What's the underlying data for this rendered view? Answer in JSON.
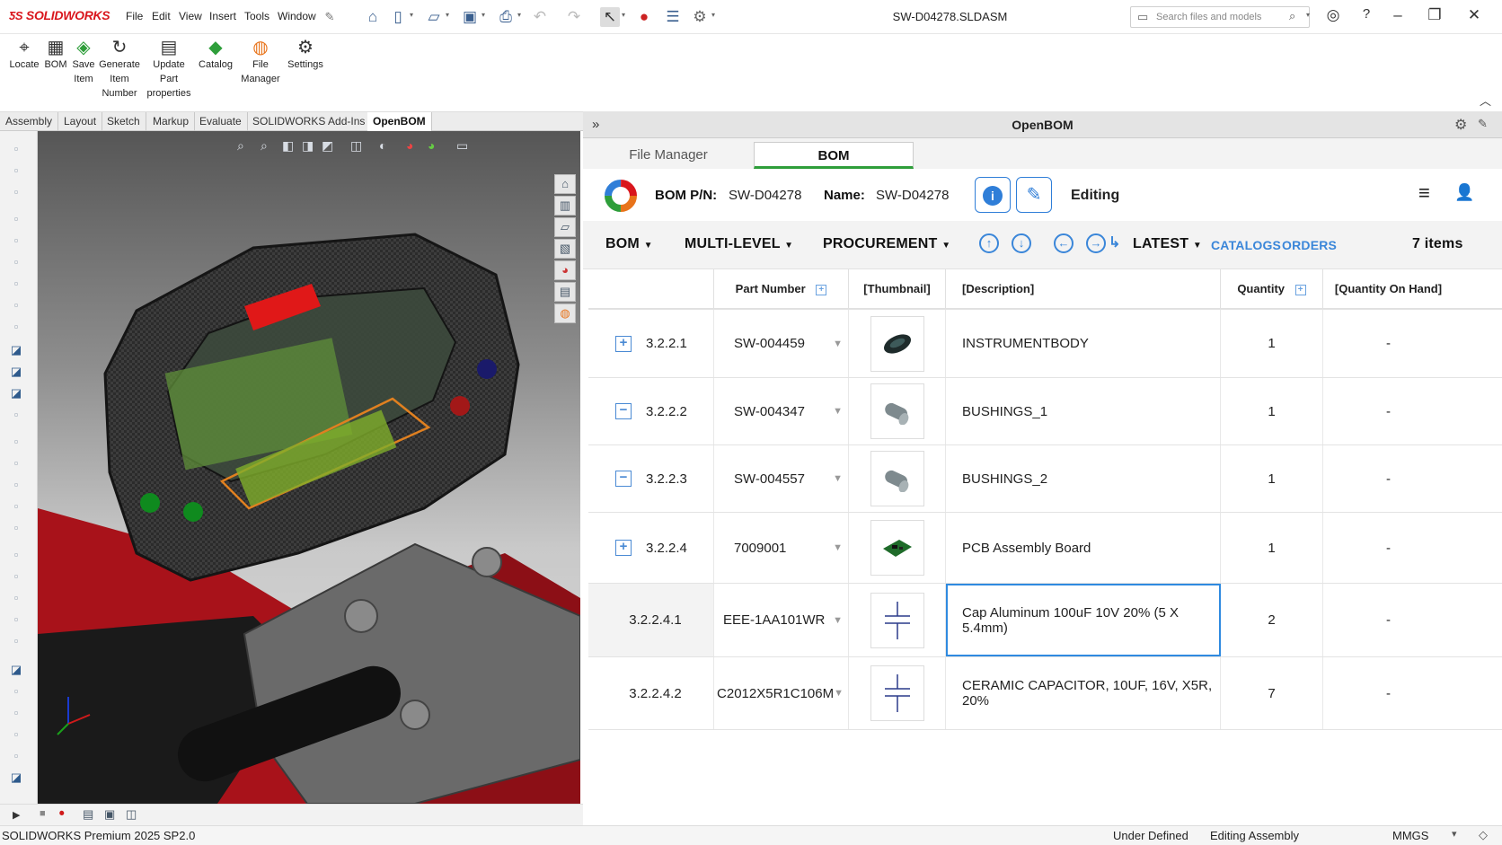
{
  "app": {
    "brand": "SOLIDWORKS",
    "window_title": "SW-D04278.SLDASM",
    "menus": [
      "File",
      "Edit",
      "View",
      "Insert",
      "Tools",
      "Window"
    ],
    "search_placeholder": "Search files and models"
  },
  "ribbon": {
    "buttons": [
      {
        "label": "Locate",
        "icon": "pin-icon"
      },
      {
        "label": "BOM",
        "icon": "grid-icon"
      },
      {
        "label": "Save Item",
        "icon": "cube-icon"
      },
      {
        "label": "Generate Item Number",
        "icon": "refresh-icon"
      },
      {
        "label": "Update Part properties",
        "icon": "document-refresh-icon"
      },
      {
        "label": "Catalog",
        "icon": "cube-stack-icon"
      },
      {
        "label": "File Manager",
        "icon": "openbom-ring-icon"
      },
      {
        "label": "Settings",
        "icon": "gear-icon"
      }
    ]
  },
  "cmd_tabs": [
    "Assembly",
    "Layout",
    "Sketch",
    "Markup",
    "Evaluate",
    "SOLIDWORKS Add-Ins",
    "OpenBOM"
  ],
  "active_cmd_tab": "OpenBOM",
  "panel": {
    "title": "OpenBOM",
    "tabs": [
      "File Manager",
      "BOM"
    ],
    "active_tab": "BOM",
    "bom_pn_label": "BOM P/N:",
    "bom_pn_value": "SW-D04278",
    "name_label": "Name:",
    "name_value": "SW-D04278",
    "mode": "Editing",
    "toolbar": {
      "bom": "BOM",
      "multilevel": "MULTI-LEVEL",
      "procurement": "PROCUREMENT",
      "latest": "LATEST",
      "catalogs": "CATALOGS",
      "orders": "ORDERS",
      "count": "7 items"
    },
    "columns": [
      "Part Number",
      "[Thumbnail]",
      "[Description]",
      "Quantity",
      "[Quantity On Hand]"
    ],
    "rows": [
      {
        "level": "3.2.2.1",
        "expander": "+",
        "part": "SW-004459",
        "desc": "INSTRUMENTBODY",
        "qty": "1",
        "onhand": "-",
        "thumb": "instrument-body-thumbnail"
      },
      {
        "level": "3.2.2.2",
        "expander": "−",
        "part": "SW-004347",
        "desc": "BUSHINGS_1",
        "qty": "1",
        "onhand": "-",
        "thumb": "bushing-thumbnail"
      },
      {
        "level": "3.2.2.3",
        "expander": "−",
        "part": "SW-004557",
        "desc": "BUSHINGS_2",
        "qty": "1",
        "onhand": "-",
        "thumb": "bushing-thumbnail"
      },
      {
        "level": "3.2.2.4",
        "expander": "+",
        "part": "7009001",
        "desc": "PCB Assembly Board",
        "qty": "1",
        "onhand": "-",
        "thumb": "pcb-thumbnail"
      },
      {
        "level": "3.2.2.4.1",
        "expander": "",
        "part": "EEE-1AA101WR",
        "desc": "Cap Aluminum 100uF 10V 20% (5 X 5.4mm)",
        "qty": "2",
        "onhand": "-",
        "thumb": "capacitor-symbol"
      },
      {
        "level": "3.2.2.4.2",
        "expander": "",
        "part": "C2012X5R1C106M",
        "desc": "CERAMIC CAPACITOR, 10UF, 16V, X5R, 20%",
        "qty": "7",
        "onhand": "-",
        "thumb": "capacitor-symbol"
      }
    ],
    "selected_cell": "Cap Aluminum 100uF 10V 20% (5 X 5.4mm)"
  },
  "status": {
    "product": "SOLIDWORKS Premium 2025 SP2.0",
    "definition": "Under Defined",
    "mode": "Editing Assembly",
    "units": "MMGS"
  },
  "colors": {
    "accent": "#2f7ed8",
    "brand": "#d9161d",
    "link": "#3a86d9"
  }
}
